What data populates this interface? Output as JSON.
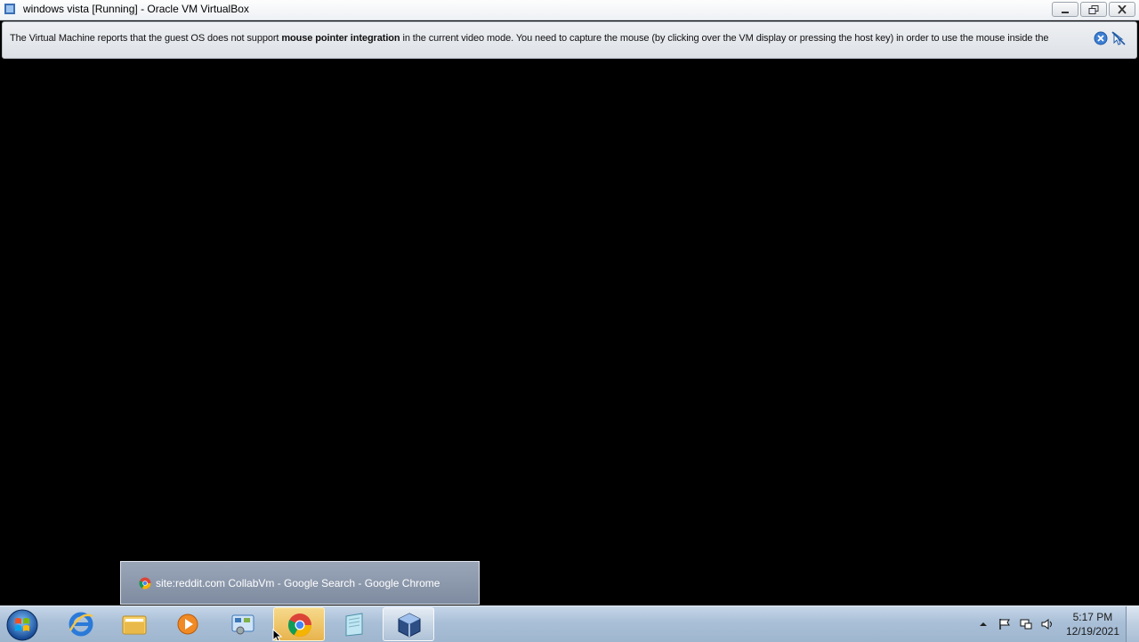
{
  "window": {
    "title": "windows vista [Running] - Oracle VM VirtualBox"
  },
  "notification": {
    "text_before": "The Virtual Machine reports that the guest OS does not support ",
    "text_bold": "mouse pointer integration",
    "text_after": " in the current video mode. You need to capture the mouse (by clicking over the VM display or pressing the host key) in order to use the mouse inside the"
  },
  "tooltip": {
    "text": "site:reddit.com CollabVm - Google Search - Google Chrome"
  },
  "taskbar": {
    "items": [
      {
        "name": "internet-explorer"
      },
      {
        "name": "windows-explorer"
      },
      {
        "name": "media-player"
      },
      {
        "name": "control-panel"
      },
      {
        "name": "google-chrome"
      },
      {
        "name": "notepad"
      },
      {
        "name": "virtualbox"
      }
    ],
    "clock": {
      "time": "5:17 PM",
      "date": "12/19/2021"
    }
  },
  "colors": {
    "taskbar": "#a9bfd7",
    "notification_bg": "#e3e6ea",
    "vm_display": "#000000",
    "tooltip_bg": "#8a97ab"
  }
}
